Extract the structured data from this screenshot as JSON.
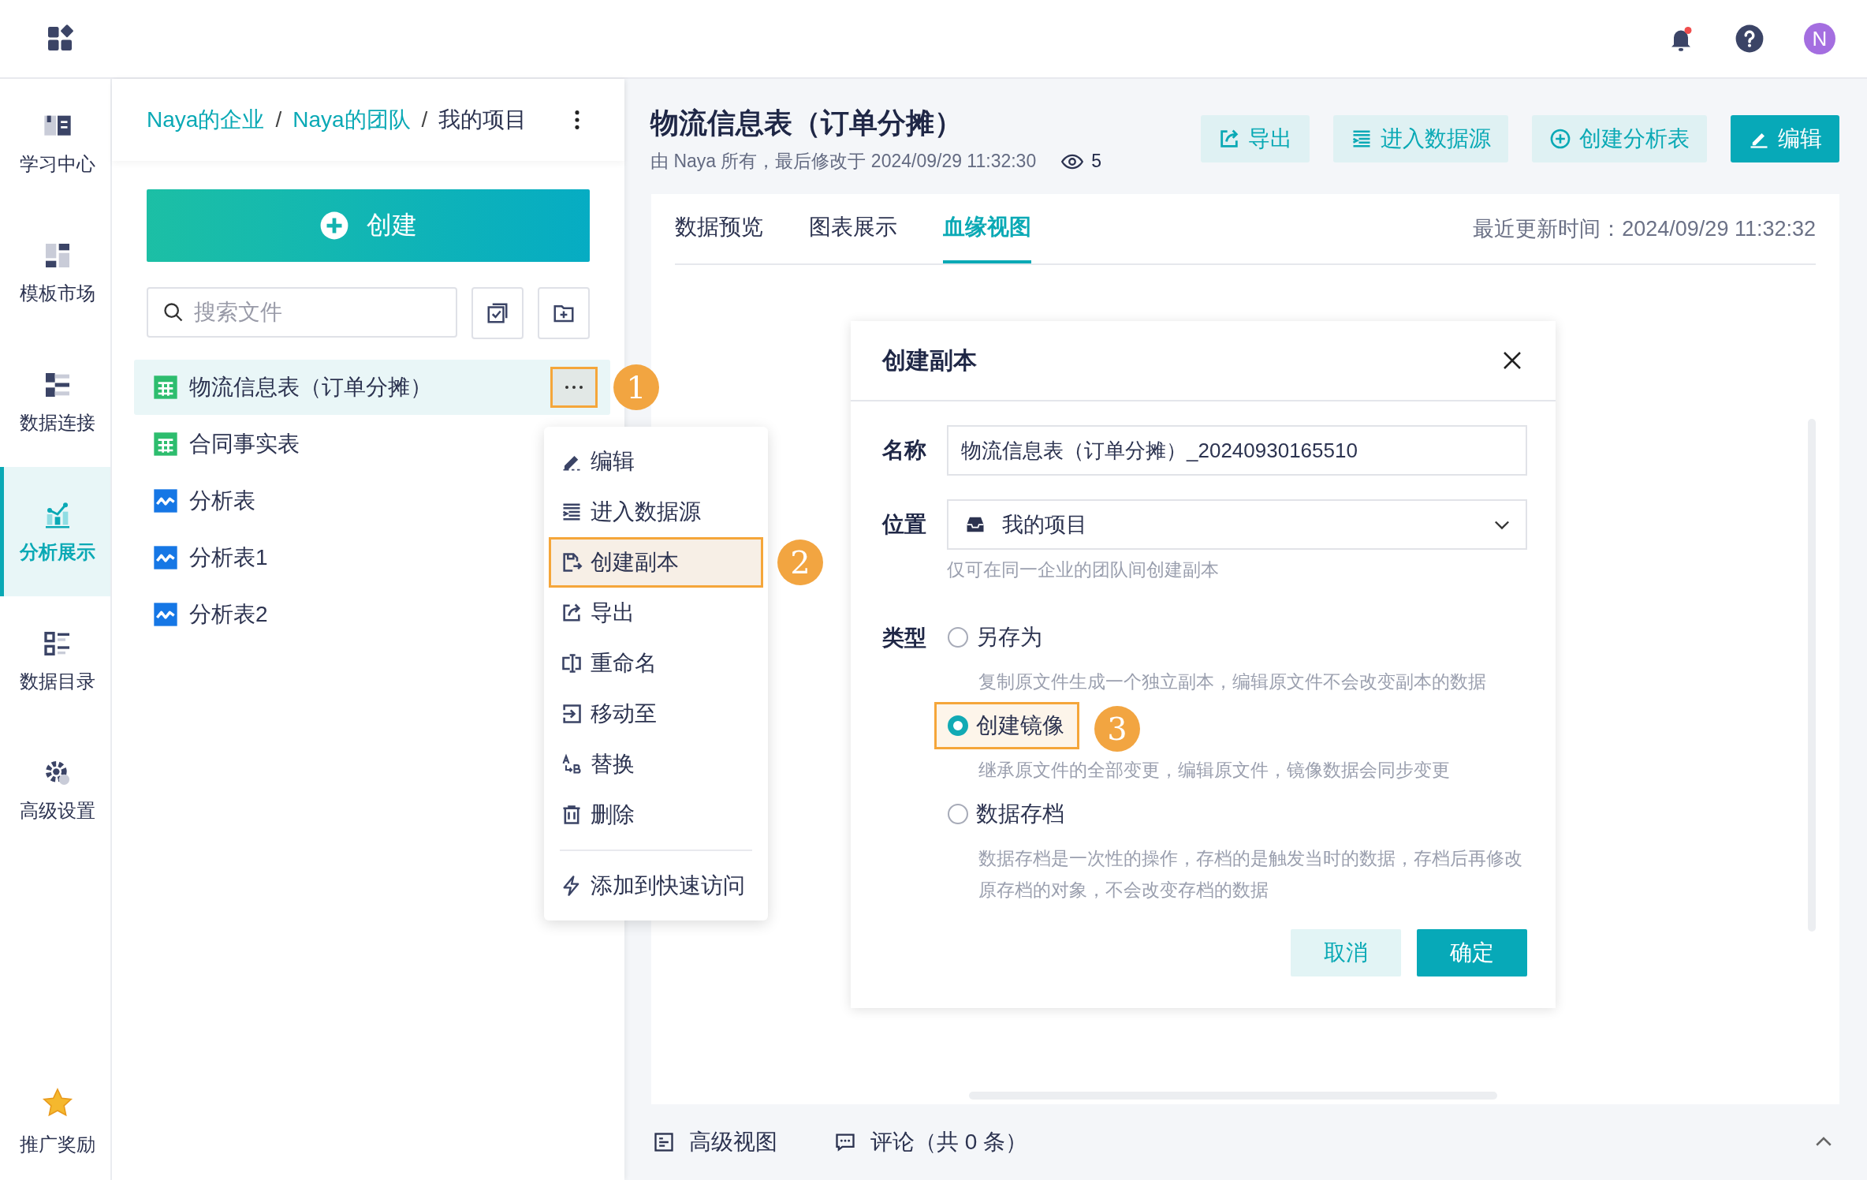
{
  "topbar": {
    "avatar": "N"
  },
  "nav": [
    {
      "label": "学习中心",
      "selected": false
    },
    {
      "label": "模板市场",
      "selected": false
    },
    {
      "label": "数据连接",
      "selected": false
    },
    {
      "label": "分析展示",
      "selected": true
    },
    {
      "label": "数据目录",
      "selected": false
    },
    {
      "label": "高级设置",
      "selected": false
    },
    {
      "label": "推广奖励",
      "selected": false
    }
  ],
  "breadcrumb_separator": "/",
  "breadcrumb": [
    {
      "label": "Naya的企业",
      "kind": "link"
    },
    {
      "label": "Naya的团队",
      "kind": "link"
    },
    {
      "label": "我的项目",
      "kind": "current"
    }
  ],
  "create_button": "创建",
  "search": {
    "placeholder": "搜索文件"
  },
  "files": [
    {
      "name": "物流信息表（订单分摊）",
      "kind": "table",
      "selected": true,
      "callout": "1"
    },
    {
      "name": "合同事实表",
      "kind": "table",
      "selected": false
    },
    {
      "name": "分析表",
      "kind": "chart",
      "selected": false
    },
    {
      "name": "分析表1",
      "kind": "chart",
      "selected": false
    },
    {
      "name": "分析表2",
      "kind": "chart",
      "selected": false
    }
  ],
  "context_menu": {
    "items": [
      {
        "label": "编辑",
        "highlighted": false
      },
      {
        "label": "进入数据源",
        "highlighted": false
      },
      {
        "label": "创建副本",
        "highlighted": true,
        "callout": "2"
      },
      {
        "label": "导出",
        "highlighted": false
      },
      {
        "label": "重命名",
        "highlighted": false
      },
      {
        "label": "移动至",
        "highlighted": false
      },
      {
        "label": "替换",
        "highlighted": false
      },
      {
        "label": "删除",
        "highlighted": false
      }
    ],
    "footer_item": "添加到快速访问"
  },
  "document": {
    "title": "物流信息表（订单分摊）",
    "meta": "由 Naya 所有，最后修改于 2024/09/29 11:32:30",
    "views": "5",
    "actions": [
      {
        "label": "导出",
        "kind": "secondary"
      },
      {
        "label": "进入数据源",
        "kind": "secondary"
      },
      {
        "label": "创建分析表",
        "kind": "secondary"
      },
      {
        "label": "编辑",
        "kind": "primary"
      }
    ]
  },
  "tabs": [
    {
      "label": "数据预览",
      "selected": false
    },
    {
      "label": "图表展示",
      "selected": false
    },
    {
      "label": "血缘视图",
      "selected": true
    }
  ],
  "last_updated": "最近更新时间：2024/09/29 11:32:32",
  "dialog": {
    "title": "创建副本",
    "name_label": "名称",
    "name_value": "物流信息表（订单分摊）_20240930165510",
    "location_label": "位置",
    "location_value": "我的项目",
    "location_hint": "仅可在同一企业的团队间创建副本",
    "type_label": "类型",
    "options": [
      {
        "label": "另存为",
        "description": "复制原文件生成一个独立副本，编辑原文件不会改变副本的数据",
        "selected": false
      },
      {
        "label": "创建镜像",
        "description": "继承原文件的全部变更，编辑原文件，镜像数据会同步变更",
        "selected": true,
        "callout": "3"
      },
      {
        "label": "数据存档",
        "description": "数据存档是一次性的操作，存档的是触发当时的数据，存档后再修改原存档的对象，不会改变存档的数据",
        "selected": false
      }
    ],
    "cancel": "取消",
    "confirm": "确定"
  },
  "bottom_bar": {
    "items": [
      "高级视图",
      "评论（共 0 条）"
    ]
  }
}
